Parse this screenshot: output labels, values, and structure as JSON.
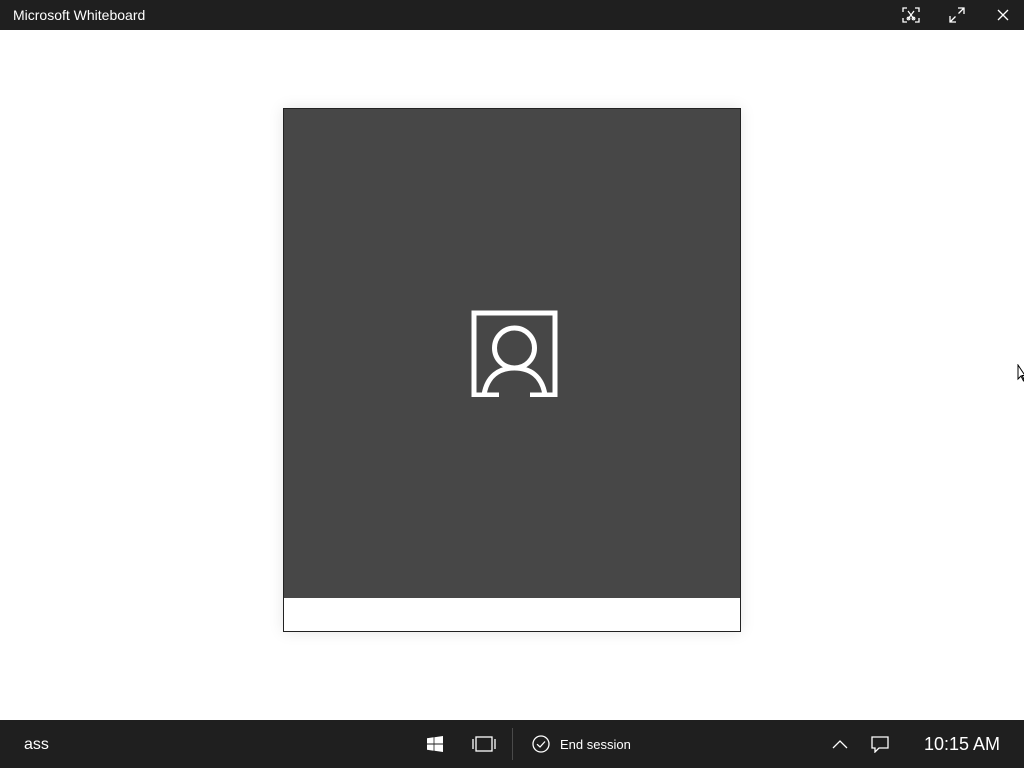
{
  "window": {
    "title": "Microsoft Whiteboard",
    "controls": [
      {
        "name": "snip-icon"
      },
      {
        "name": "expand-icon"
      },
      {
        "name": "close-icon"
      }
    ]
  },
  "card": {
    "image_icon": "person-placeholder-icon",
    "caption": ""
  },
  "taskbar": {
    "search_text": "ass",
    "end_session_label": "End session",
    "clock": "10:15 AM"
  },
  "colors": {
    "titlebar_bg": "#1f1f1f",
    "taskbar_bg": "#1f1f1f",
    "card_image_bg": "#474747",
    "icon_white": "#ffffff"
  }
}
